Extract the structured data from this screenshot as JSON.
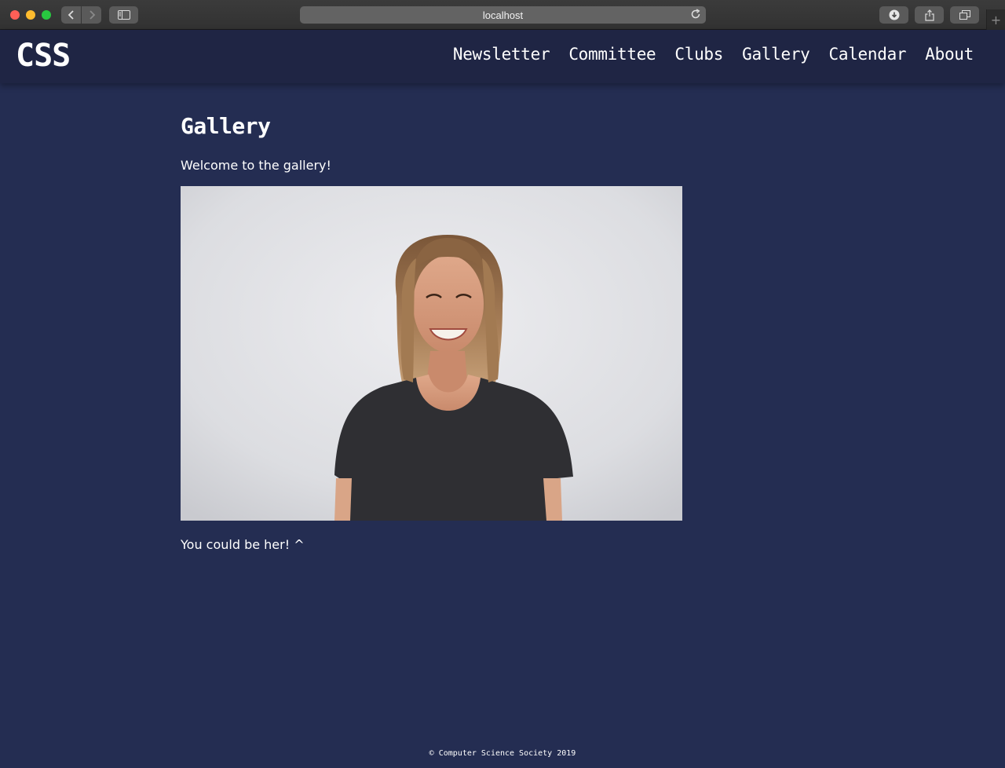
{
  "browser": {
    "url": "localhost",
    "back_icon": "chevron-left-icon",
    "forward_icon": "chevron-right-icon",
    "sidebar_icon": "sidebar-icon",
    "reload_icon": "reload-icon",
    "download_icon": "download-icon",
    "share_icon": "share-icon",
    "tabs_icon": "tabs-icon",
    "new_tab_icon": "plus-icon"
  },
  "header": {
    "logo": "CSS",
    "nav": [
      "Newsletter",
      "Committee",
      "Clubs",
      "Gallery",
      "Calendar",
      "About"
    ]
  },
  "main": {
    "title": "Gallery",
    "intro": "Welcome to the gallery!",
    "caption": "You could be her! ^"
  },
  "footer": {
    "text": "© Computer Science Society 2019"
  },
  "colors": {
    "page_background": "#242d52",
    "header_background": "#1f2544",
    "text": "#ffffff"
  }
}
